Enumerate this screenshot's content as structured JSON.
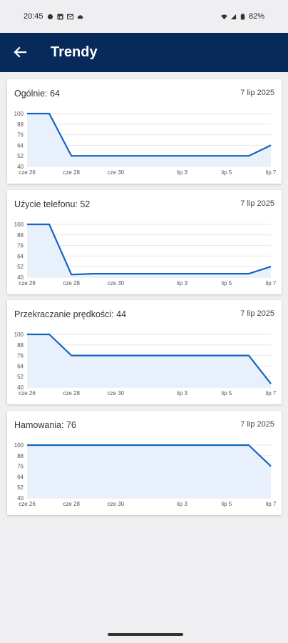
{
  "status_bar": {
    "time": "20:45",
    "battery": "82%",
    "icons": [
      "dot-icon",
      "linkedin-icon",
      "mail-icon",
      "cloud-icon",
      "wifi-icon",
      "signal-icon",
      "battery-icon"
    ]
  },
  "app_bar": {
    "title": "Trendy",
    "back_icon": "arrow-left-icon"
  },
  "colors": {
    "app_bar": "#072a5a",
    "line": "#1565c0",
    "fill": "#e8f1fb"
  },
  "cards": [
    {
      "label": "Ogólnie: 64",
      "date": "7 lip 2025"
    },
    {
      "label": "Użycie telefonu: 52",
      "date": "7 lip 2025"
    },
    {
      "label": "Przekraczanie prędkości: 44",
      "date": "7 lip 2025"
    },
    {
      "label": "Hamowania: 76",
      "date": "7 lip 2025"
    }
  ],
  "chart_data": [
    {
      "type": "area",
      "x": [
        "cze 26",
        "cze 27",
        "cze 28",
        "cze 29",
        "cze 30",
        "lip 1",
        "lip 2",
        "lip 3",
        "lip 4",
        "lip 5",
        "lip 6",
        "lip 7"
      ],
      "x_ticks": [
        "cze 26",
        "cze 28",
        "cze 30",
        "lip 3",
        "lip 5",
        "lip 7"
      ],
      "y_ticks": [
        100,
        88,
        76,
        64,
        52,
        40
      ],
      "ylim": [
        40,
        100
      ],
      "series": [
        {
          "values": [
            100,
            100,
            52,
            52,
            52,
            52,
            52,
            52,
            52,
            52,
            52,
            64
          ]
        }
      ]
    },
    {
      "type": "area",
      "x": [
        "cze 26",
        "cze 27",
        "cze 28",
        "cze 29",
        "cze 30",
        "lip 1",
        "lip 2",
        "lip 3",
        "lip 4",
        "lip 5",
        "lip 6",
        "lip 7"
      ],
      "x_ticks": [
        "cze 26",
        "cze 28",
        "cze 30",
        "lip 3",
        "lip 5",
        "lip 7"
      ],
      "y_ticks": [
        100,
        88,
        76,
        64,
        52,
        40
      ],
      "ylim": [
        40,
        100
      ],
      "series": [
        {
          "values": [
            100,
            100,
            43,
            44,
            44,
            44,
            44,
            44,
            44,
            44,
            44,
            52
          ]
        }
      ]
    },
    {
      "type": "area",
      "x": [
        "cze 26",
        "cze 27",
        "cze 28",
        "cze 29",
        "cze 30",
        "lip 1",
        "lip 2",
        "lip 3",
        "lip 4",
        "lip 5",
        "lip 6",
        "lip 7"
      ],
      "x_ticks": [
        "cze 26",
        "cze 28",
        "cze 30",
        "lip 3",
        "lip 5",
        "lip 7"
      ],
      "y_ticks": [
        100,
        88,
        76,
        64,
        52,
        40
      ],
      "ylim": [
        40,
        100
      ],
      "series": [
        {
          "values": [
            100,
            100,
            76,
            76,
            76,
            76,
            76,
            76,
            76,
            76,
            76,
            44
          ]
        }
      ]
    },
    {
      "type": "area",
      "x": [
        "cze 26",
        "cze 27",
        "cze 28",
        "cze 29",
        "cze 30",
        "lip 1",
        "lip 2",
        "lip 3",
        "lip 4",
        "lip 5",
        "lip 6",
        "lip 7"
      ],
      "x_ticks": [
        "cze 26",
        "cze 28",
        "cze 30",
        "lip 3",
        "lip 5",
        "lip 7"
      ],
      "y_ticks": [
        100,
        88,
        76,
        64,
        52,
        40
      ],
      "ylim": [
        40,
        100
      ],
      "series": [
        {
          "values": [
            100,
            100,
            100,
            100,
            100,
            100,
            100,
            100,
            100,
            100,
            100,
            76
          ]
        }
      ]
    }
  ]
}
